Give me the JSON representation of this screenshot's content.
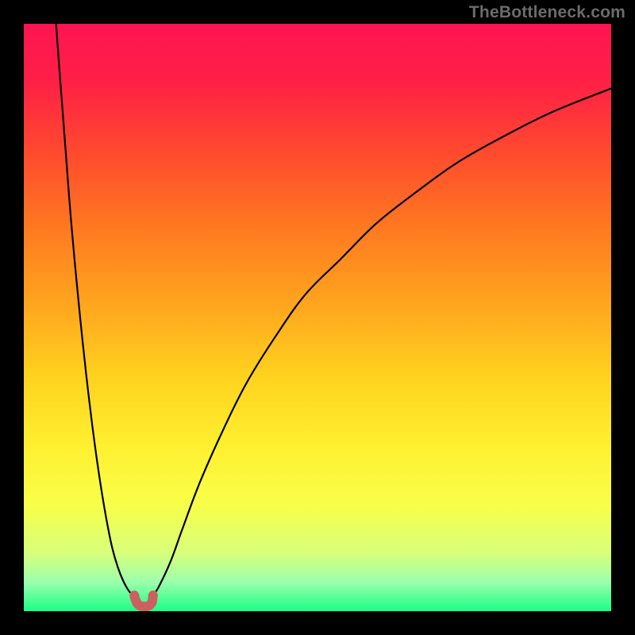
{
  "watermark": "TheBottleneck.com",
  "gradient_stops": [
    {
      "offset": 0.0,
      "color": "#ff1452"
    },
    {
      "offset": 0.1,
      "color": "#ff2045"
    },
    {
      "offset": 0.22,
      "color": "#ff4a2e"
    },
    {
      "offset": 0.35,
      "color": "#ff7a20"
    },
    {
      "offset": 0.48,
      "color": "#ffa61e"
    },
    {
      "offset": 0.6,
      "color": "#ffd21e"
    },
    {
      "offset": 0.72,
      "color": "#fff030"
    },
    {
      "offset": 0.82,
      "color": "#f7ff4a"
    },
    {
      "offset": 0.9,
      "color": "#d8ff7a"
    },
    {
      "offset": 0.95,
      "color": "#9cffad"
    },
    {
      "offset": 1.0,
      "color": "#1aff87"
    }
  ],
  "chart_data": {
    "type": "line",
    "title": "",
    "xlabel": "",
    "ylabel": "",
    "xlim": [
      0,
      100
    ],
    "ylim": [
      0,
      100
    ],
    "series": [
      {
        "name": "left-branch",
        "stroke": "#000000",
        "stroke_width": 2.2,
        "x": [
          5.5,
          6,
          7,
          8,
          9,
          10,
          11,
          12,
          13,
          14,
          15,
          16,
          17,
          18,
          18.8
        ],
        "y": [
          100,
          93,
          80,
          67,
          56,
          46,
          37,
          29,
          22,
          16,
          11,
          7.5,
          5,
          3.3,
          2.7
        ]
      },
      {
        "name": "right-branch",
        "stroke": "#000000",
        "stroke_width": 2.2,
        "x": [
          22,
          23,
          25,
          27,
          30,
          34,
          38,
          43,
          48,
          54,
          60,
          67,
          74,
          82,
          90,
          100
        ],
        "y": [
          2.7,
          4.2,
          8.5,
          14,
          22,
          31,
          39,
          47,
          54,
          60,
          66,
          71.5,
          76.5,
          81,
          85,
          89
        ]
      },
      {
        "name": "bottom-marker",
        "stroke": "#cb6060",
        "stroke_width": 12,
        "linecap": "round",
        "x": [
          18.8,
          19.2,
          19.8,
          20.5,
          21.2,
          21.8,
          22.0
        ],
        "y": [
          2.7,
          1.5,
          0.9,
          0.8,
          0.9,
          1.5,
          2.7
        ]
      }
    ]
  }
}
